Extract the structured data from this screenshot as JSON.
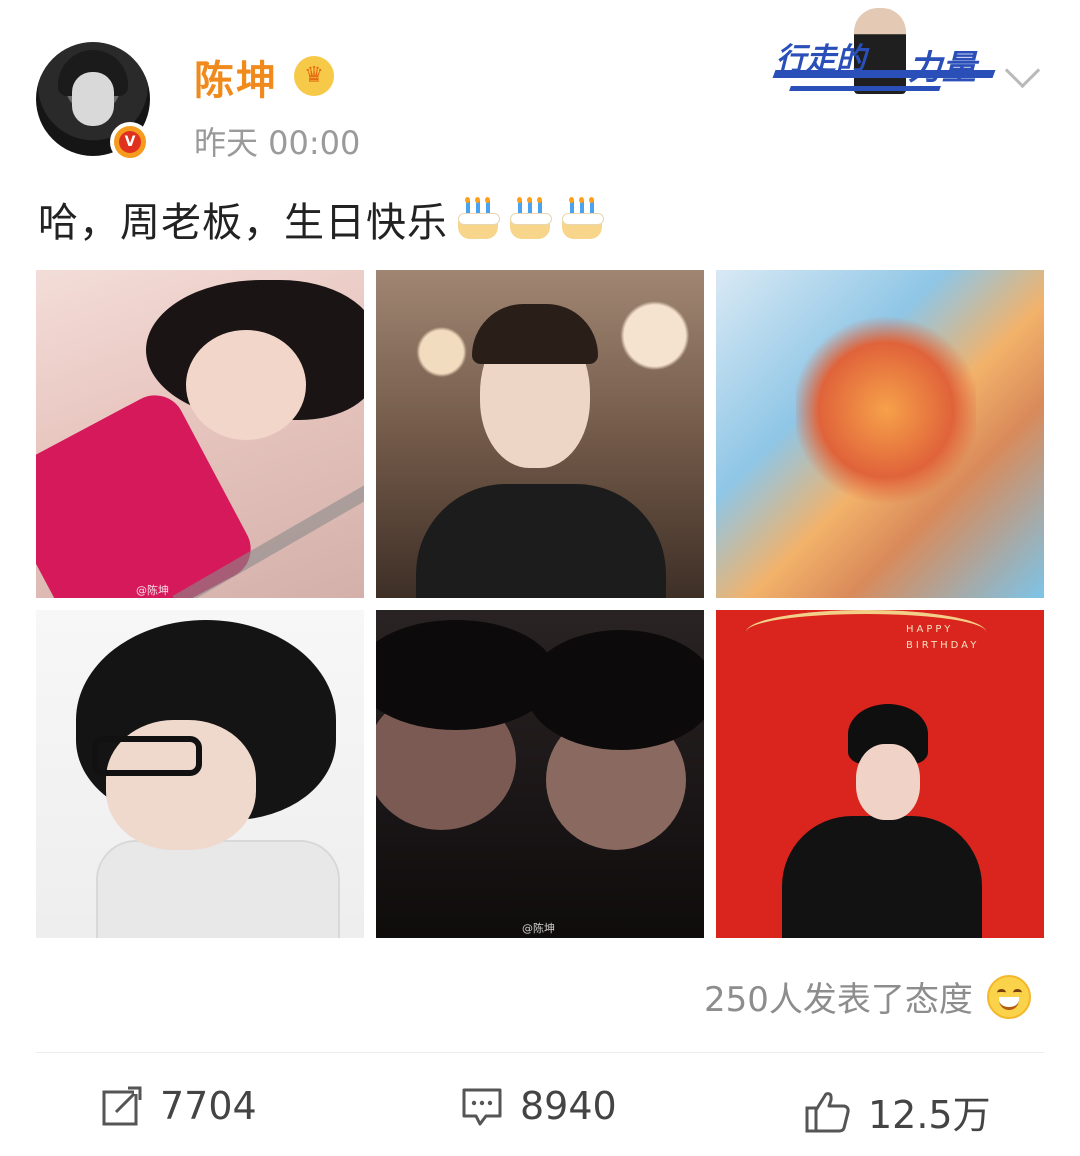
{
  "post": {
    "author": "陈坤",
    "timestamp": "昨天 00:00",
    "text": "哈，周老板，生日快乐",
    "cake_emoji_count": 3,
    "verified_badge_color": "#f59b1f",
    "username_color": "#f08a1c"
  },
  "banner": {
    "line1": "行走的",
    "line2": "力量",
    "color": "#2a4fb8"
  },
  "photos": {
    "watermark": "@陈坤",
    "count": 6
  },
  "reactions": {
    "text": "250人发表了态度"
  },
  "actions": {
    "repost_count": "7704",
    "comment_count": "8940",
    "like_count": "12.5万"
  },
  "icons": {
    "verified": "verified-v-icon",
    "crown": "crown-icon",
    "more": "chevron-down-icon",
    "cake": "cake-emoji-icon",
    "laugh": "laugh-emoji-icon",
    "repost": "repost-icon",
    "comment": "comment-icon",
    "like": "thumbs-up-icon"
  }
}
